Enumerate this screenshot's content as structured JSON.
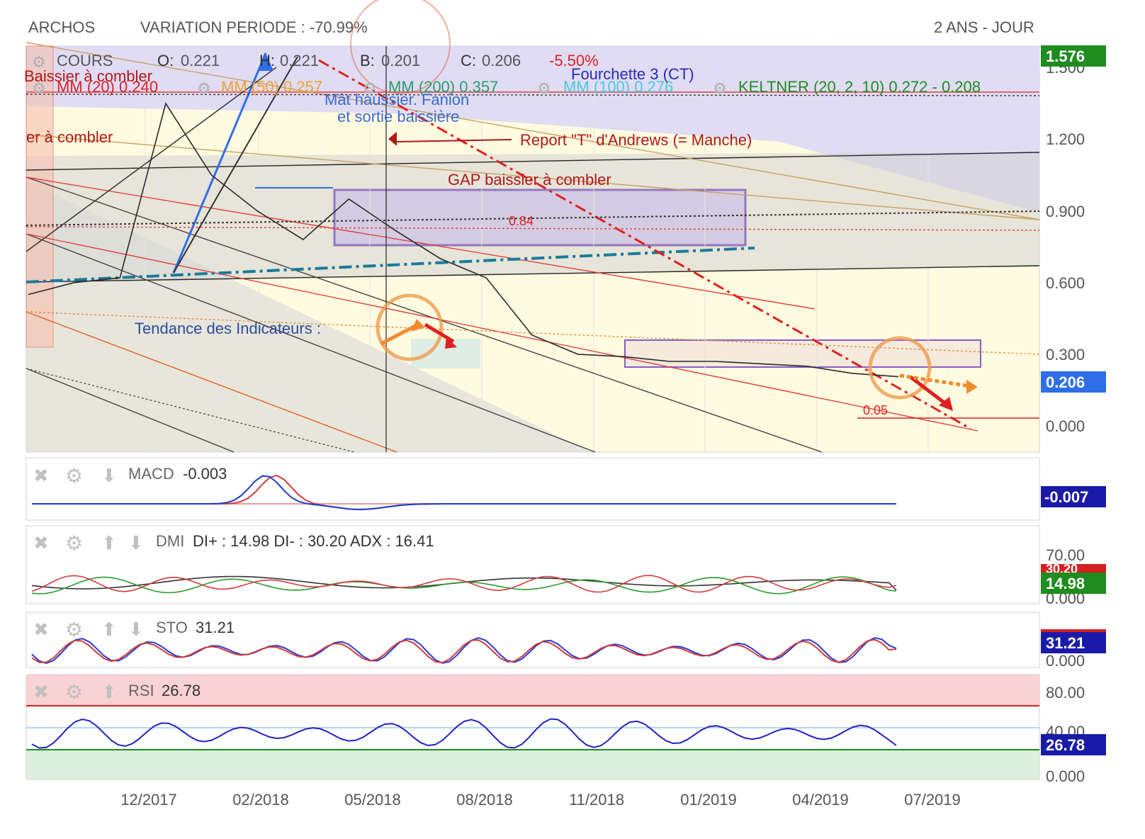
{
  "header": {
    "ticker": "ARCHOS",
    "variation": "VARIATION PERIODE : -70.99%",
    "period": "2 ANS - JOUR"
  },
  "main_panel": {
    "cours_label": "COURS",
    "o_label": "O:",
    "o_value": "0.221",
    "h_label": "H:",
    "h_value": "0.221",
    "b_label": "B:",
    "b_value": "0.201",
    "c_label": "C:",
    "c_value": "0.206",
    "change": "-5.50%",
    "mm20": "MM (20) 0.240",
    "mm50": "MM (50) 0.257",
    "mm200": "MM (200) 0.357",
    "mm100": "MM (100) 0.276",
    "keltner": "KELTNER (20, 2, 10) 0.272 - 0.208",
    "ann_fourchette": "Fourchette 3 (CT)",
    "ann_mat1": "Mât haussier. Fanion",
    "ann_mat2": "et sortie baissière",
    "ann_andrews": "Report \"T\" d'Andrews (= Manche)",
    "ann_gap": "GAP baissier à combler",
    "ann_gap_left1": "Baissier à combler",
    "ann_gap_left2": "er à combler",
    "ann_tendance": "Tendance des Indicateurs :",
    "ann_084": "0.84",
    "ann_005": "0.05",
    "y_ticks": [
      "1.200",
      "0.900",
      "0.600",
      "0.300",
      "0.000"
    ],
    "badge_top": "1.576",
    "badge_top_under": "1.500",
    "badge_last": "0.206"
  },
  "macd_panel": {
    "label": "MACD",
    "value": "-0.003",
    "badge": "-0.007"
  },
  "dmi_panel": {
    "label": "DMI",
    "value": "DI+ : 14.98 DI- : 30.20 ADX : 16.41",
    "tick_top": "70.00",
    "tick_bottom": "0.000",
    "badge_red": "30.20",
    "badge_green": "14.98"
  },
  "sto_panel": {
    "label": "STO",
    "value": "31.21",
    "tick_bottom": "0.000",
    "badge": "31.21"
  },
  "rsi_panel": {
    "label": "RSI",
    "value": "26.78",
    "tick_top": "80.00",
    "tick_mid": "40.00",
    "tick_bottom": "0.000",
    "badge": "26.78"
  },
  "x_axis": {
    "labels": [
      "12/2017",
      "02/2018",
      "05/2018",
      "08/2018",
      "11/2018",
      "01/2019",
      "04/2019",
      "07/2019"
    ]
  },
  "colors": {
    "up": "#2a9d2a",
    "down": "#d9362b",
    "badge_green": "#1f8c1f",
    "badge_blue": "#1a1aa8",
    "badge_blue_light": "#2f6ee8",
    "violet_zone": "#dcd8f6",
    "yellow_zone": "#fffbe0",
    "macd_line": "#1f3cc8",
    "signal_line": "#d33b3b"
  },
  "chart_data": {
    "type": "line",
    "title": "ARCHOS",
    "xlabel": "",
    "ylabel": "",
    "ylim": [
      0,
      1.6
    ],
    "x": [
      "12/2017",
      "02/2018",
      "05/2018",
      "08/2018",
      "11/2018",
      "01/2019",
      "04/2019",
      "07/2019"
    ],
    "series": [
      {
        "name": "COURS",
        "values": [
          0.55,
          0.6,
          0.62,
          1.35,
          1.05,
          0.9,
          0.78,
          0.95,
          0.82,
          0.7,
          0.62,
          0.38,
          0.3,
          0.29,
          0.27,
          0.27,
          0.26,
          0.25,
          0.22,
          0.206
        ]
      }
    ],
    "indicators": {
      "MACD": -0.003,
      "DI+": 14.98,
      "DI-": 30.2,
      "ADX": 16.41,
      "STO": 31.21,
      "RSI": 26.78
    }
  }
}
